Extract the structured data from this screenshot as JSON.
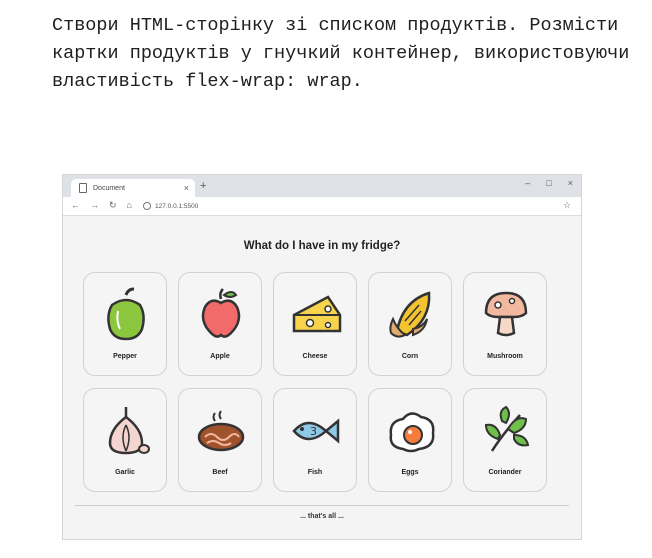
{
  "task_text": "Створи HTML-сторінку зі списком продуктів. Розмісти картки продуктів у гнучкий контейнер, використовуючи властивість flex-wrap: wrap.",
  "browser": {
    "tab_title": "Document",
    "tab_close": "×",
    "new_tab": "+",
    "url": "127.0.0.1:5500",
    "window_controls": [
      "–",
      "□",
      "×"
    ]
  },
  "page": {
    "heading": "What do I have in my fridge?",
    "products": [
      {
        "label": "Pepper",
        "icon": "pepper-icon"
      },
      {
        "label": "Apple",
        "icon": "apple-icon"
      },
      {
        "label": "Cheese",
        "icon": "cheese-icon"
      },
      {
        "label": "Corn",
        "icon": "corn-icon"
      },
      {
        "label": "Mushroom",
        "icon": "mushroom-icon"
      },
      {
        "label": "Garlic",
        "icon": "garlic-icon"
      },
      {
        "label": "Beef",
        "icon": "beef-icon"
      },
      {
        "label": "Fish",
        "icon": "fish-icon"
      },
      {
        "label": "Eggs",
        "icon": "egg-icon"
      },
      {
        "label": "Coriander",
        "icon": "coriander-icon"
      }
    ],
    "footer": "... that's all ..."
  },
  "colors": {
    "pepper": "#8cc63f",
    "apple": "#f26b6b",
    "cheese": "#f7d44c",
    "corn": "#f4c430",
    "mushroom": "#f2b8a0",
    "garlic": "#f5d5cf",
    "beef": "#a0522d",
    "fish": "#8ec9e8",
    "egg": "#f47c3c",
    "coriander": "#6fbf4a",
    "outline": "#333333"
  }
}
